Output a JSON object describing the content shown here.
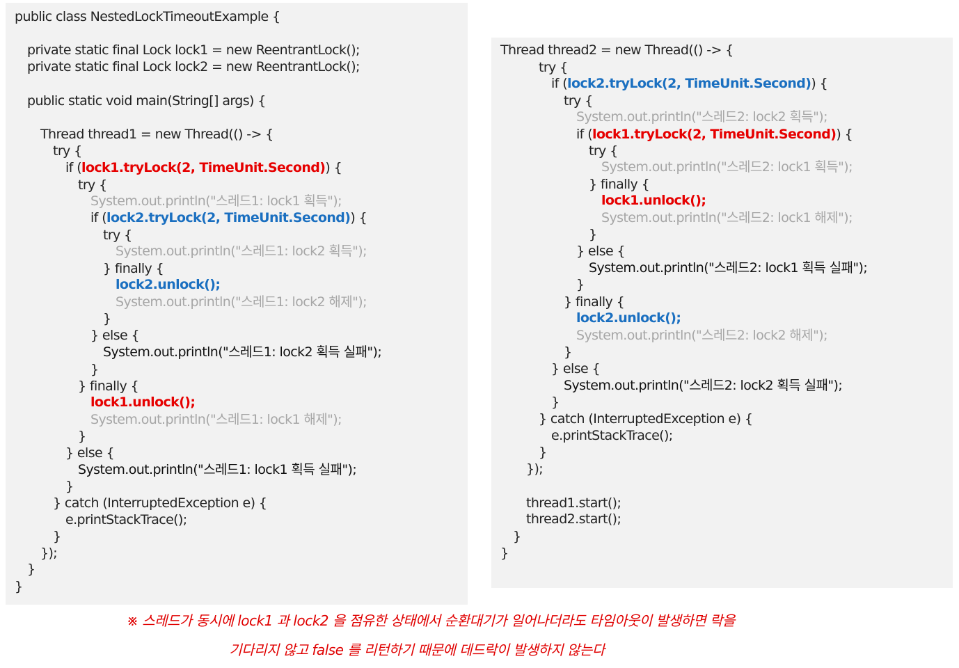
{
  "left_code": {
    "lines": [
      [
        {
          "t": "public class NestedLockTimeoutExample {",
          "s": "plain"
        }
      ],
      [
        {
          "t": "private static final Lock lock1 = new ReentrantLock();",
          "s": "plain"
        }
      ],
      [
        {
          "t": "private static final Lock lock2 = new ReentrantLock();",
          "s": "plain"
        }
      ],
      [
        {
          "t": "public static void main(String[] args) {",
          "s": "plain"
        }
      ],
      [
        {
          "t": "Thread thread1 = new Thread(() -> {",
          "s": "plain"
        }
      ],
      [
        {
          "t": "try {",
          "s": "plain"
        }
      ],
      [
        {
          "t": "if (",
          "s": "plain"
        },
        {
          "t": "lock1.tryLock(2, TimeUnit.Second)",
          "s": "red"
        },
        {
          "t": ") {",
          "s": "plain"
        }
      ],
      [
        {
          "t": "try {",
          "s": "plain"
        }
      ],
      [
        {
          "t": "System.out.println(\"스레드1: lock1 획득\");",
          "s": "gray"
        }
      ],
      [
        {
          "t": "if (",
          "s": "plain"
        },
        {
          "t": "lock2.tryLock(2, TimeUnit.Second)",
          "s": "blue"
        },
        {
          "t": ") {",
          "s": "plain"
        }
      ],
      [
        {
          "t": "try {",
          "s": "plain"
        }
      ],
      [
        {
          "t": "System.out.println(\"스레드1: lock2 획득\");",
          "s": "gray"
        }
      ],
      [
        {
          "t": "} finally {",
          "s": "plain"
        }
      ],
      [
        {
          "t": "lock2.unlock();",
          "s": "blue"
        }
      ],
      [
        {
          "t": "System.out.println(\"스레드1: lock2 해제\");",
          "s": "gray"
        }
      ],
      [
        {
          "t": "}",
          "s": "plain"
        }
      ],
      [
        {
          "t": "} else {",
          "s": "plain"
        }
      ],
      [
        {
          "t": "System.out.println(\"스레드1: lock2 획득 실패\");",
          "s": "black"
        }
      ],
      [
        {
          "t": "}",
          "s": "plain"
        }
      ],
      [
        {
          "t": "} finally {",
          "s": "plain"
        }
      ],
      [
        {
          "t": "lock1.unlock();",
          "s": "red"
        }
      ],
      [
        {
          "t": "System.out.println(\"스레드1: lock1 해제\");",
          "s": "gray"
        }
      ],
      [
        {
          "t": "}",
          "s": "plain"
        }
      ],
      [
        {
          "t": "} else {",
          "s": "plain"
        }
      ],
      [
        {
          "t": "System.out.println(\"스레드1: lock1 획득 실패\");",
          "s": "black"
        }
      ],
      [
        {
          "t": "}",
          "s": "plain"
        }
      ],
      [
        {
          "t": "} catch (InterruptedException e) {",
          "s": "plain"
        }
      ],
      [
        {
          "t": "e.printStackTrace();",
          "s": "plain"
        }
      ],
      [
        {
          "t": "}",
          "s": "plain"
        }
      ],
      [
        {
          "t": "});",
          "s": "plain"
        }
      ],
      [
        {
          "t": "}",
          "s": "plain"
        }
      ],
      [
        {
          "t": "}",
          "s": "plain"
        }
      ]
    ]
  },
  "right_code": {
    "lines": [
      [
        {
          "t": "Thread thread2 = new Thread(() -> {",
          "s": "plain"
        }
      ],
      [
        {
          "t": "try {",
          "s": "plain"
        }
      ],
      [
        {
          "t": "if (",
          "s": "plain"
        },
        {
          "t": "lock2.tryLock(2, TimeUnit.Second)",
          "s": "blue"
        },
        {
          "t": ") {",
          "s": "plain"
        }
      ],
      [
        {
          "t": "try {",
          "s": "plain"
        }
      ],
      [
        {
          "t": "System.out.println(\"스레드2: lock2 획득\");",
          "s": "gray"
        }
      ],
      [
        {
          "t": "if (",
          "s": "plain"
        },
        {
          "t": "lock1.tryLock(2, TimeUnit.Second)",
          "s": "red"
        },
        {
          "t": ") {",
          "s": "plain"
        }
      ],
      [
        {
          "t": "try {",
          "s": "plain"
        }
      ],
      [
        {
          "t": "System.out.println(\"스레드2: lock1 획득\");",
          "s": "gray"
        }
      ],
      [
        {
          "t": "} finally {",
          "s": "plain"
        }
      ],
      [
        {
          "t": "lock1.unlock();",
          "s": "red"
        }
      ],
      [
        {
          "t": "System.out.println(\"스레드2: lock1 해제\");",
          "s": "gray"
        }
      ],
      [
        {
          "t": "}",
          "s": "plain"
        }
      ],
      [
        {
          "t": "} else {",
          "s": "plain"
        }
      ],
      [
        {
          "t": "System.out.println(\"스레드2: lock1 획득 실패\");",
          "s": "black"
        }
      ],
      [
        {
          "t": "}",
          "s": "plain"
        }
      ],
      [
        {
          "t": "} finally {",
          "s": "plain"
        }
      ],
      [
        {
          "t": "lock2.unlock();",
          "s": "blue"
        }
      ],
      [
        {
          "t": "System.out.println(\"스레드2: lock2 해제\");",
          "s": "gray"
        }
      ],
      [
        {
          "t": "}",
          "s": "plain"
        }
      ],
      [
        {
          "t": "} else {",
          "s": "plain"
        }
      ],
      [
        {
          "t": "System.out.println(\"스레드2: lock2 획득 실패\");",
          "s": "black"
        }
      ],
      [
        {
          "t": "}",
          "s": "plain"
        }
      ],
      [
        {
          "t": "} catch (InterruptedException e) {",
          "s": "plain"
        }
      ],
      [
        {
          "t": "e.printStackTrace();",
          "s": "plain"
        }
      ],
      [
        {
          "t": "}",
          "s": "plain"
        }
      ],
      [
        {
          "t": "});",
          "s": "plain"
        }
      ],
      [
        {
          "t": "thread1.start();",
          "s": "plain"
        }
      ],
      [
        {
          "t": "thread2.start();",
          "s": "plain"
        }
      ],
      [
        {
          "t": "}",
          "s": "plain"
        }
      ],
      [
        {
          "t": "}",
          "s": "plain"
        }
      ]
    ]
  },
  "note": {
    "line1": "※ 스레드가 동시에 lock1 과 lock2 을 점유한 상태에서 순환대기가 일어나더라도 타임아웃이 발생하면 락을",
    "line2": "기다리지 않고 false 를 리턴하기 때문에 데드락이 발생하지 않는다"
  },
  "colors": {
    "panel_background": "#f2f2f2",
    "plain_text": "#222222",
    "comment_gray": "#a6a6a6",
    "lock1_red": "#e60000",
    "lock2_blue": "#1a6fc0",
    "note_red": "#e00000"
  }
}
